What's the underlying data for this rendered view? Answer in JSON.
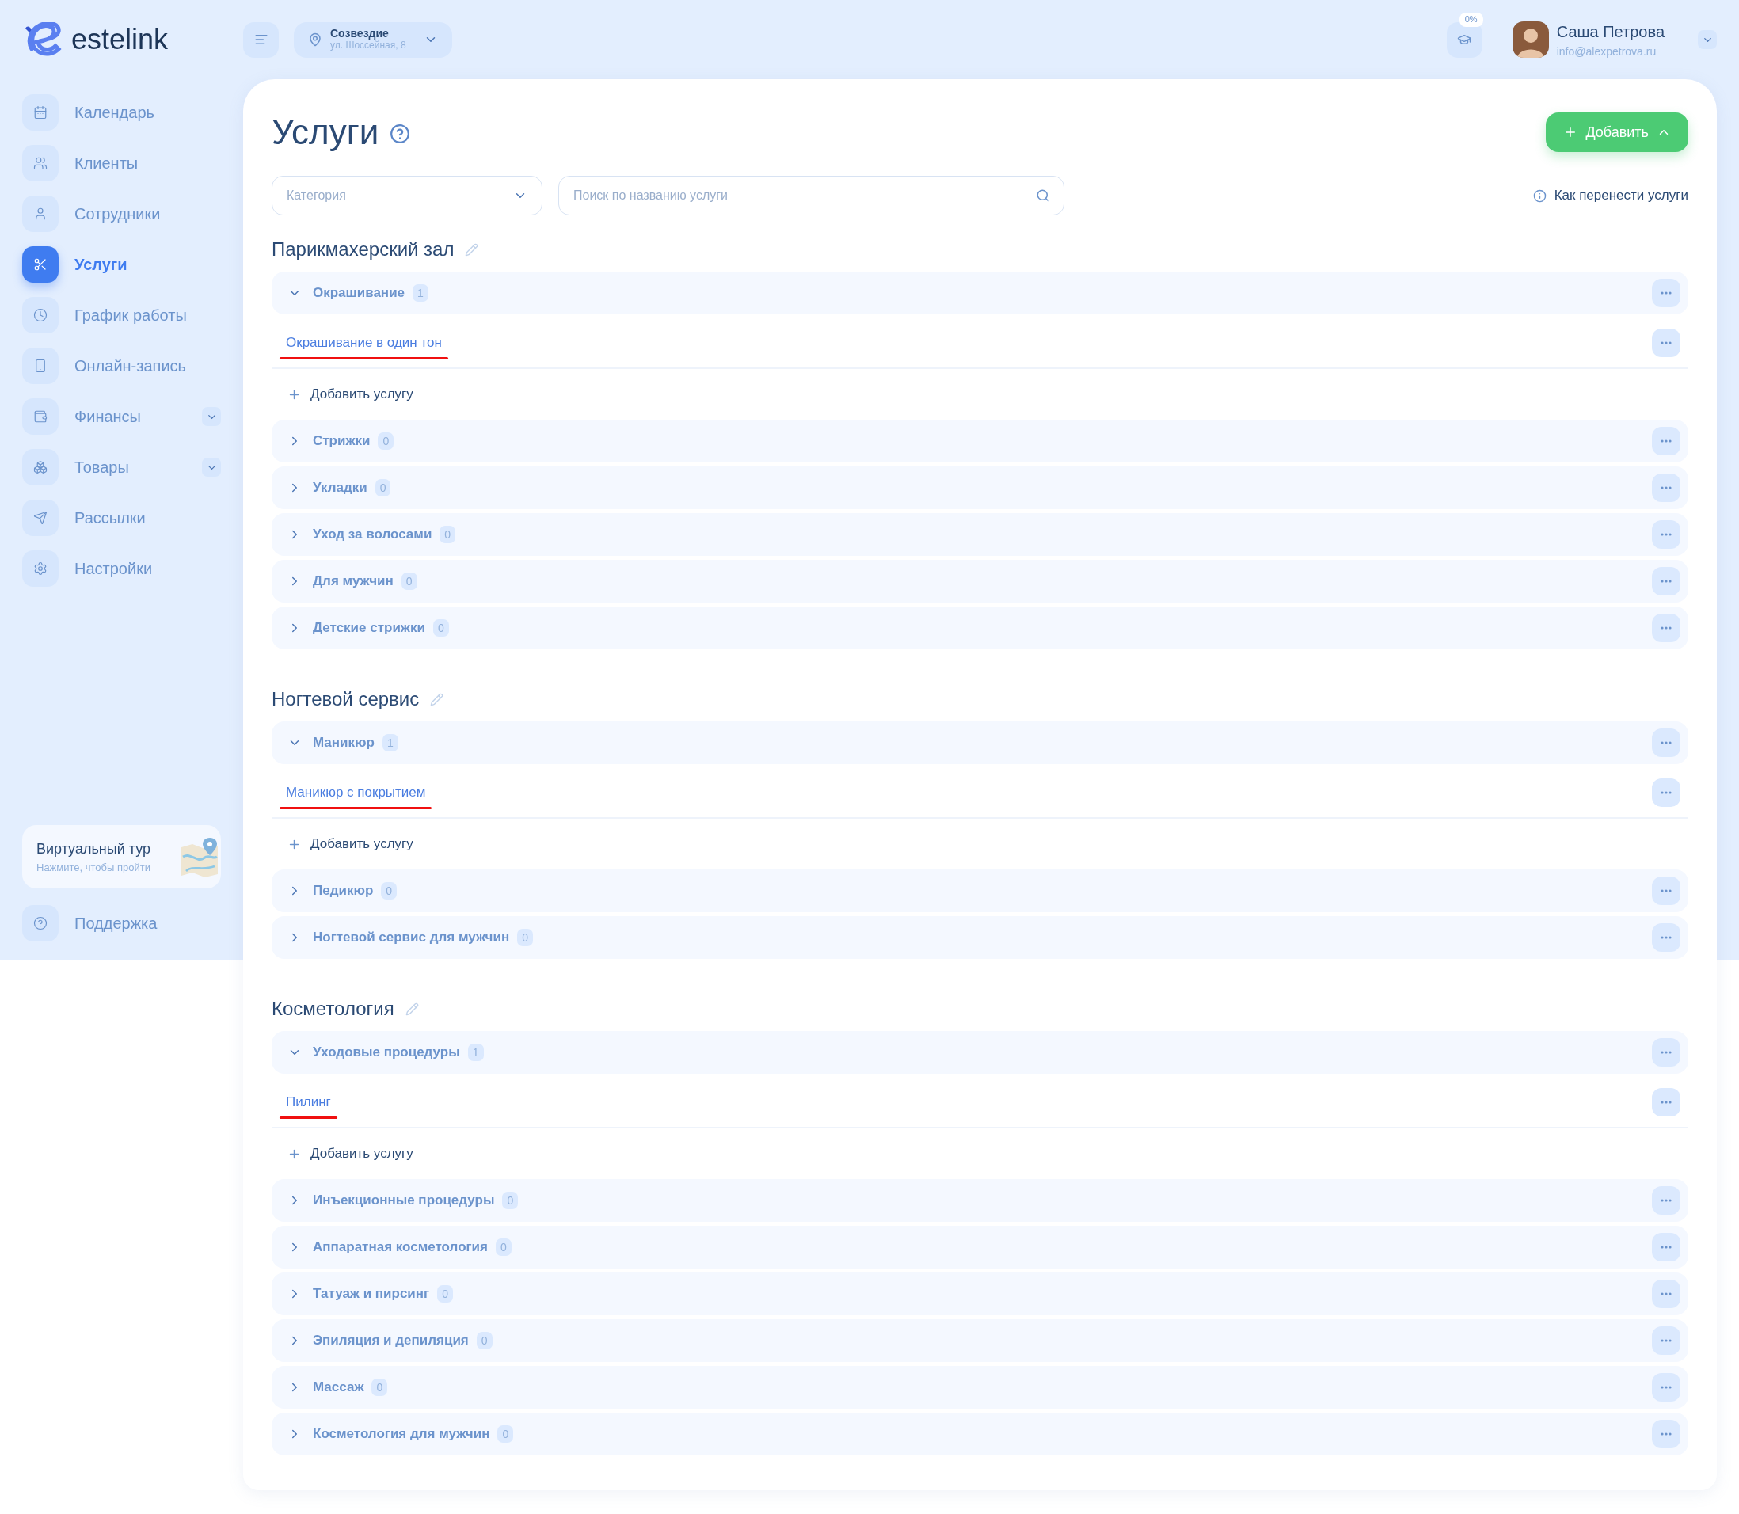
{
  "logo": {
    "text": "estelink"
  },
  "location": {
    "name": "Созвездие",
    "address": "ул. Шоссейная, 8"
  },
  "progress_badge": "0%",
  "user": {
    "name": "Саша Петрова",
    "email": "info@alexpetrova.ru"
  },
  "sidebar": {
    "items": [
      {
        "label": "Календарь",
        "selected": false,
        "expandable": false
      },
      {
        "label": "Клиенты",
        "selected": false,
        "expandable": false
      },
      {
        "label": "Сотрудники",
        "selected": false,
        "expandable": false
      },
      {
        "label": "Услуги",
        "selected": true,
        "expandable": false
      },
      {
        "label": "График работы",
        "selected": false,
        "expandable": false
      },
      {
        "label": "Онлайн-запись",
        "selected": false,
        "expandable": false
      },
      {
        "label": "Финансы",
        "selected": false,
        "expandable": true
      },
      {
        "label": "Товары",
        "selected": false,
        "expandable": true
      },
      {
        "label": "Рассылки",
        "selected": false,
        "expandable": false
      },
      {
        "label": "Настройки",
        "selected": false,
        "expandable": false
      }
    ]
  },
  "virtual_tour": {
    "title": "Виртуальный тур",
    "subtitle": "Нажмите, чтобы пройти"
  },
  "support": {
    "label": "Поддержка"
  },
  "page": {
    "title": "Услуги",
    "add_button": "Добавить",
    "category_select": {
      "placeholder": "Категория"
    },
    "search": {
      "placeholder": "Поиск по названию услуги"
    },
    "help_link": "Как перенести услуги"
  },
  "sections": [
    {
      "title": "Парикмахерский зал",
      "categories": [
        {
          "name": "Окрашивание",
          "count": "1",
          "expanded": true,
          "services": [
            {
              "name": "Окрашивание в один тон",
              "underlined": true
            }
          ],
          "add_label": "Добавить услугу"
        },
        {
          "name": "Стрижки",
          "count": "0",
          "expanded": false
        },
        {
          "name": "Укладки",
          "count": "0",
          "expanded": false
        },
        {
          "name": "Уход за волосами",
          "count": "0",
          "expanded": false
        },
        {
          "name": "Для мужчин",
          "count": "0",
          "expanded": false
        },
        {
          "name": "Детские стрижки",
          "count": "0",
          "expanded": false
        }
      ]
    },
    {
      "title": "Ногтевой сервис",
      "categories": [
        {
          "name": "Маникюр",
          "count": "1",
          "expanded": true,
          "services": [
            {
              "name": "Маникюр с покрытием",
              "underlined": true
            }
          ],
          "add_label": "Добавить услугу"
        },
        {
          "name": "Педикюр",
          "count": "0",
          "expanded": false
        },
        {
          "name": "Ногтевой сервис для мужчин",
          "count": "0",
          "expanded": false
        }
      ]
    },
    {
      "title": "Косметология",
      "categories": [
        {
          "name": "Уходовые процедуры",
          "count": "1",
          "expanded": true,
          "services": [
            {
              "name": "Пилинг",
              "underlined": true
            }
          ],
          "add_label": "Добавить услугу"
        },
        {
          "name": "Инъекционные процедуры",
          "count": "0",
          "expanded": false
        },
        {
          "name": "Аппаратная косметология",
          "count": "0",
          "expanded": false
        },
        {
          "name": "Татуаж и пирсинг",
          "count": "0",
          "expanded": false
        },
        {
          "name": "Эпиляция и депиляция",
          "count": "0",
          "expanded": false
        },
        {
          "name": "Массаж",
          "count": "0",
          "expanded": false
        },
        {
          "name": "Косметология для мужчин",
          "count": "0",
          "expanded": false
        }
      ]
    }
  ]
}
